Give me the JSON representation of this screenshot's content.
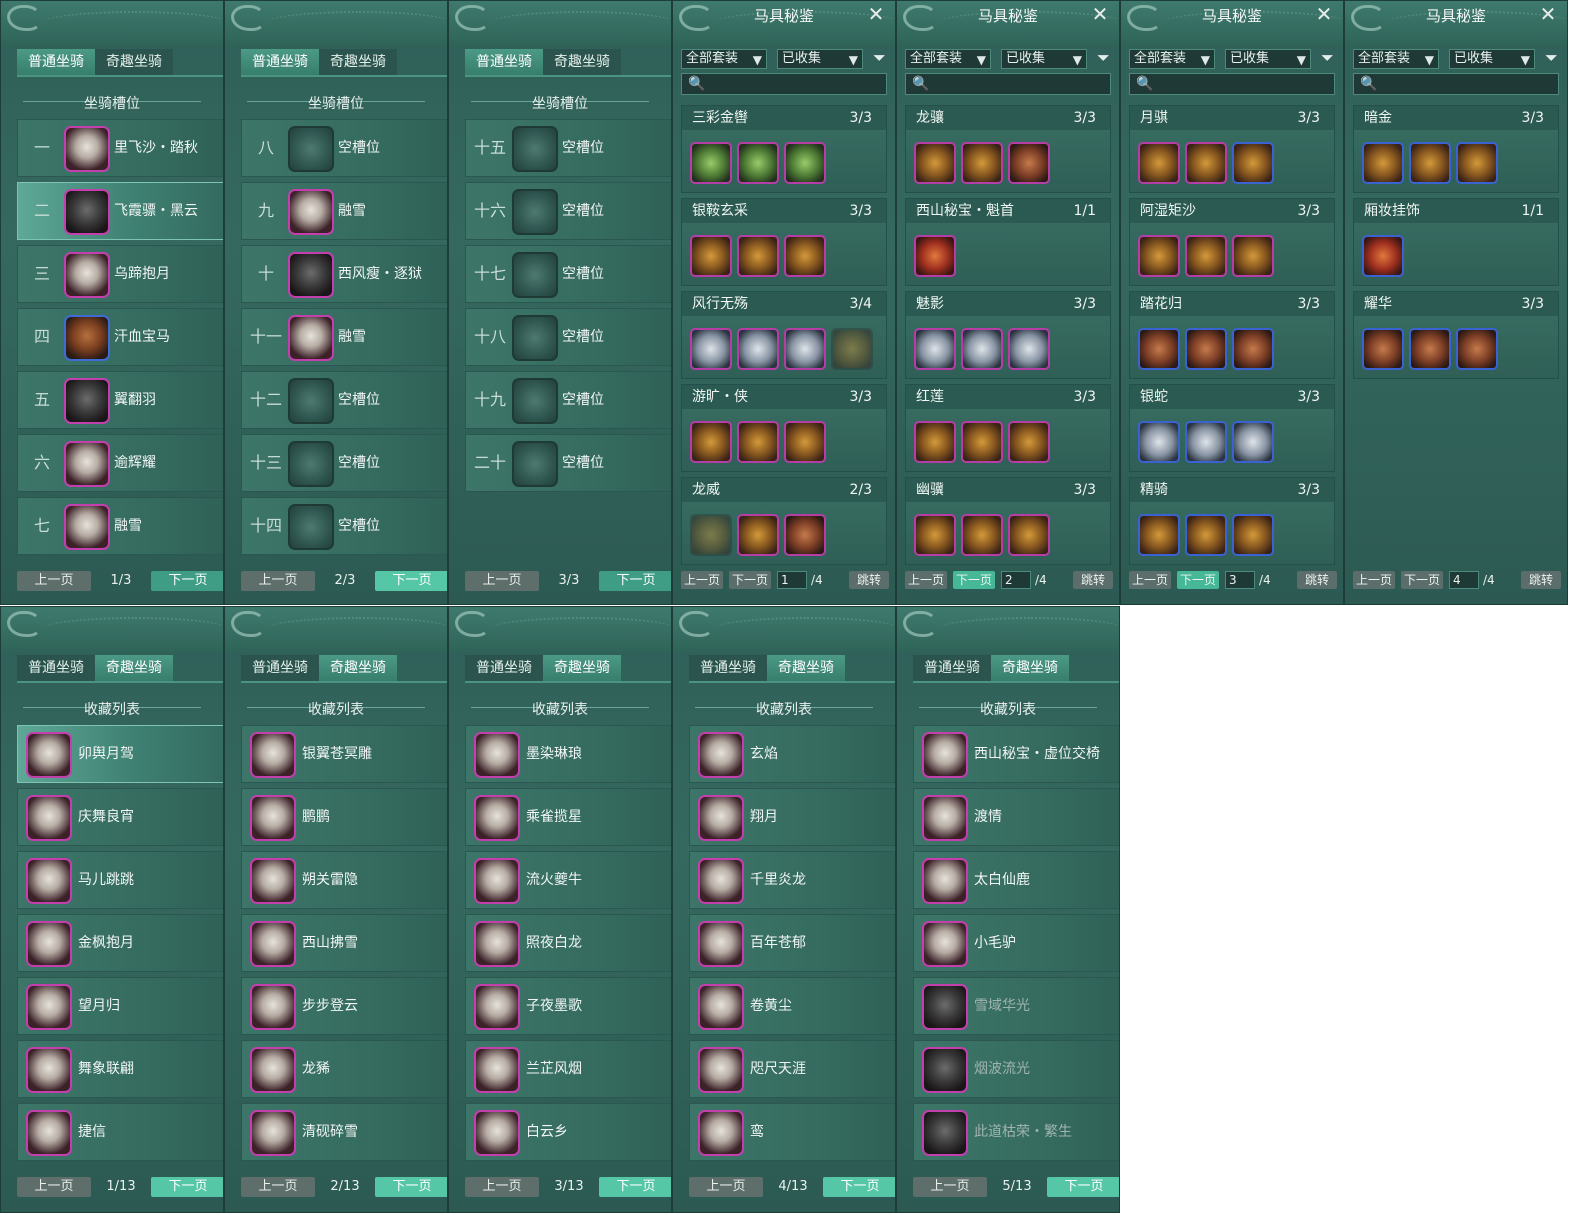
{
  "mount_tabs": {
    "normal": "普通坐骑",
    "fancy": "奇趣坐骑"
  },
  "slot_section_title": "坐骑槽位",
  "collection_section_title": "收藏列表",
  "gear_title": "马具秘鉴",
  "close_glyph": "✕",
  "search_glyph": "🔍",
  "filter_glyph": "▼",
  "funnel_glyph": "⏷",
  "pager": {
    "prev": "上一页",
    "next": "下一页",
    "jump": "跳转"
  },
  "filters": {
    "set": "全部套装",
    "collected": "已收集"
  },
  "slot_pages": [
    {
      "page": "1/3",
      "rows": [
        {
          "num": "一",
          "name": "里飞沙・踏秋"
        },
        {
          "num": "二",
          "name": "飞霞骠・黑云"
        },
        {
          "num": "三",
          "name": "乌蹄抱月"
        },
        {
          "num": "四",
          "name": "汗血宝马"
        },
        {
          "num": "五",
          "name": "翼翻羽"
        },
        {
          "num": "六",
          "name": "逾辉耀"
        },
        {
          "num": "七",
          "name": "融雪"
        }
      ]
    },
    {
      "page": "2/3",
      "rows": [
        {
          "num": "八",
          "name": "空槽位"
        },
        {
          "num": "九",
          "name": "融雪"
        },
        {
          "num": "十",
          "name": "西风瘦・逐狱"
        },
        {
          "num": "十一",
          "name": "融雪"
        },
        {
          "num": "十二",
          "name": "空槽位"
        },
        {
          "num": "十三",
          "name": "空槽位"
        },
        {
          "num": "十四",
          "name": "空槽位"
        }
      ]
    },
    {
      "page": "3/3",
      "rows": [
        {
          "num": "十五",
          "name": "空槽位"
        },
        {
          "num": "十六",
          "name": "空槽位"
        },
        {
          "num": "十七",
          "name": "空槽位"
        },
        {
          "num": "十八",
          "name": "空槽位"
        },
        {
          "num": "十九",
          "name": "空槽位"
        },
        {
          "num": "二十",
          "name": "空槽位"
        }
      ]
    }
  ],
  "gear_pages": [
    {
      "page": "1",
      "total": "/4",
      "sets": [
        {
          "name": "三彩金辔",
          "count": "3/3"
        },
        {
          "name": "银鞍玄采",
          "count": "3/3"
        },
        {
          "name": "风行无殇",
          "count": "3/4"
        },
        {
          "name": "游旷・侠",
          "count": "3/3"
        },
        {
          "name": "龙威",
          "count": "2/3"
        }
      ]
    },
    {
      "page": "2",
      "total": "/4",
      "sets": [
        {
          "name": "龙骧",
          "count": "3/3"
        },
        {
          "name": "西山秘宝・魁首",
          "count": "1/1"
        },
        {
          "name": "魅影",
          "count": "3/3"
        },
        {
          "name": "红莲",
          "count": "3/3"
        },
        {
          "name": "幽骥",
          "count": "3/3"
        }
      ]
    },
    {
      "page": "3",
      "total": "/4",
      "sets": [
        {
          "name": "月骐",
          "count": "3/3"
        },
        {
          "name": "阿湿矩沙",
          "count": "3/3"
        },
        {
          "name": "踏花归",
          "count": "3/3"
        },
        {
          "name": "银蛇",
          "count": "3/3"
        },
        {
          "name": "精骑",
          "count": "3/3"
        }
      ]
    },
    {
      "page": "4",
      "total": "/4",
      "sets": [
        {
          "name": "暗金",
          "count": "3/3"
        },
        {
          "name": "厢妆挂饰",
          "count": "1/1"
        },
        {
          "name": "耀华",
          "count": "3/3"
        }
      ]
    }
  ],
  "collection_pages": [
    {
      "page": "1/13",
      "rows": [
        "卯舆月驾",
        "庆舞良宵",
        "马儿跳跳",
        "金枫抱月",
        "望月归",
        "舞象联翩",
        "捷信"
      ]
    },
    {
      "page": "2/13",
      "rows": [
        "银翼苍冥雕",
        "鹏鹏",
        "朔关雷隐",
        "西山拂雪",
        "步步登云",
        "龙豨",
        "清砚碎雪"
      ]
    },
    {
      "page": "3/13",
      "rows": [
        "墨染琳琅",
        "乘雀揽星",
        "流火夔牛",
        "照夜白龙",
        "子夜墨歌",
        "兰芷风烟",
        "白云乡"
      ]
    },
    {
      "page": "4/13",
      "rows": [
        "玄焰",
        "翔月",
        "千里炎龙",
        "百年苍郁",
        "卷黄尘",
        "咫尺天涯",
        "鸾"
      ]
    },
    {
      "page": "5/13",
      "rows": [
        "西山秘宝・虚位交椅",
        "渡情",
        "太白仙鹿",
        "小毛驴",
        "雪域华光",
        "烟波流光",
        "此道枯荣・繁生"
      ]
    }
  ]
}
